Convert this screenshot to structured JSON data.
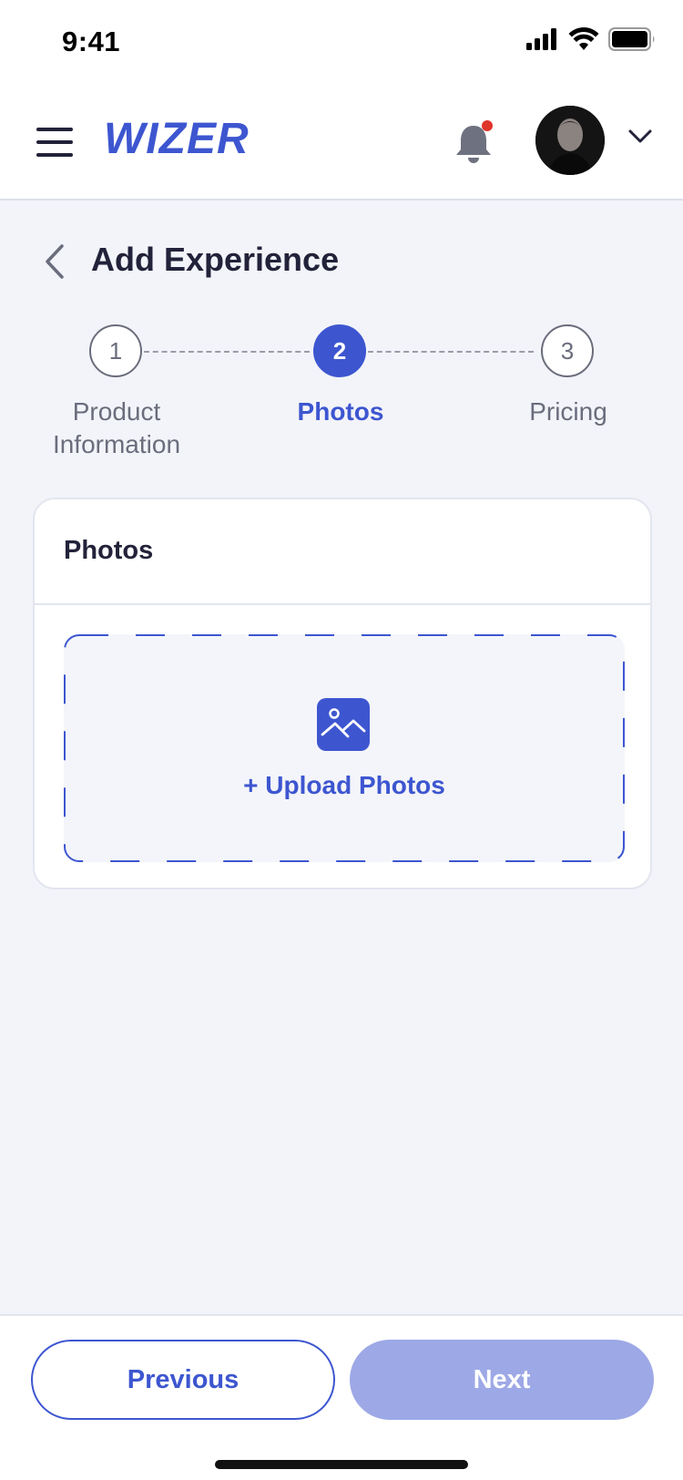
{
  "status_bar": {
    "time": "9:41"
  },
  "header": {
    "brand": "WIZER",
    "colors": {
      "brand": "#3D56D0",
      "notification_dot": "#E0352B"
    }
  },
  "page": {
    "title": "Add Experience"
  },
  "stepper": {
    "current_step": 2,
    "steps": [
      {
        "number": "1",
        "label_line1": "Product",
        "label_line2": "Information",
        "state": "inactive"
      },
      {
        "number": "2",
        "label_line1": "Photos",
        "label_line2": "",
        "state": "active"
      },
      {
        "number": "3",
        "label_line1": "Pricing",
        "label_line2": "",
        "state": "inactive"
      }
    ]
  },
  "photos_card": {
    "title": "Photos",
    "upload_label": "+ Upload Photos",
    "icon": "image-icon"
  },
  "footer": {
    "previous_label": "Previous",
    "next_label": "Next",
    "next_state": "disabled"
  }
}
